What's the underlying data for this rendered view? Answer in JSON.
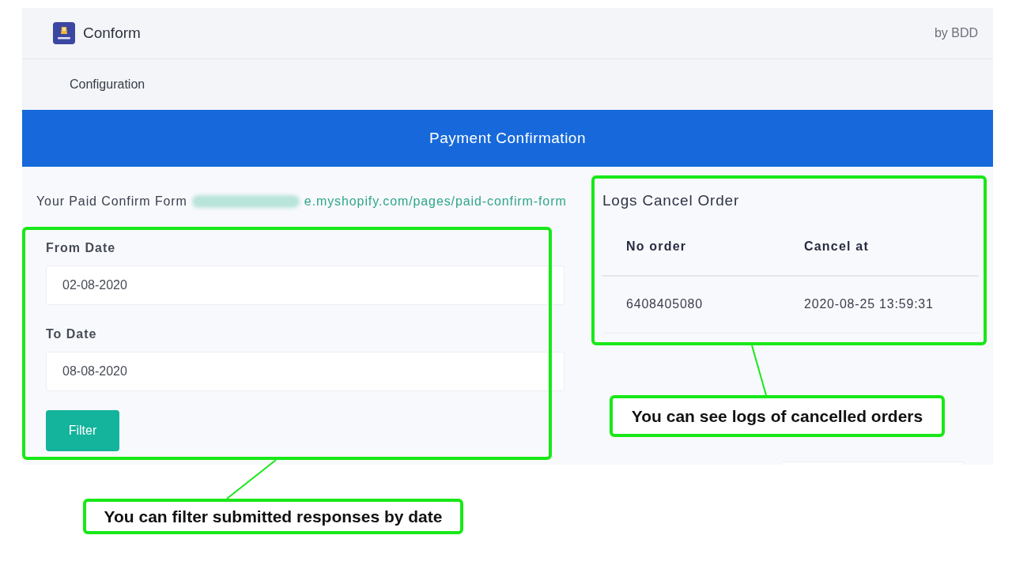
{
  "header": {
    "app_name": "Conform",
    "vendor": "by BDD"
  },
  "nav": {
    "items": [
      {
        "label": "Configuration"
      }
    ]
  },
  "banner": {
    "title": "Payment Confirmation"
  },
  "form_link": {
    "label": "Your Paid Confirm Form",
    "url": "e.myshopify.com/pages/paid-confirm-form"
  },
  "filter": {
    "fields": [
      {
        "label": "From Date",
        "value": "02-08-2020"
      },
      {
        "label": "To Date",
        "value": "08-08-2020"
      }
    ],
    "button": "Filter"
  },
  "cancel_logs": {
    "title": "Logs Cancel Order",
    "columns": [
      "No order",
      "Cancel at"
    ],
    "rows": [
      [
        "6408405080",
        "2020-08-25 13:59:31"
      ]
    ]
  },
  "annotations": [
    {
      "text": "You can see logs of cancelled orders"
    },
    {
      "text": "You can filter submitted responses by date"
    }
  ]
}
